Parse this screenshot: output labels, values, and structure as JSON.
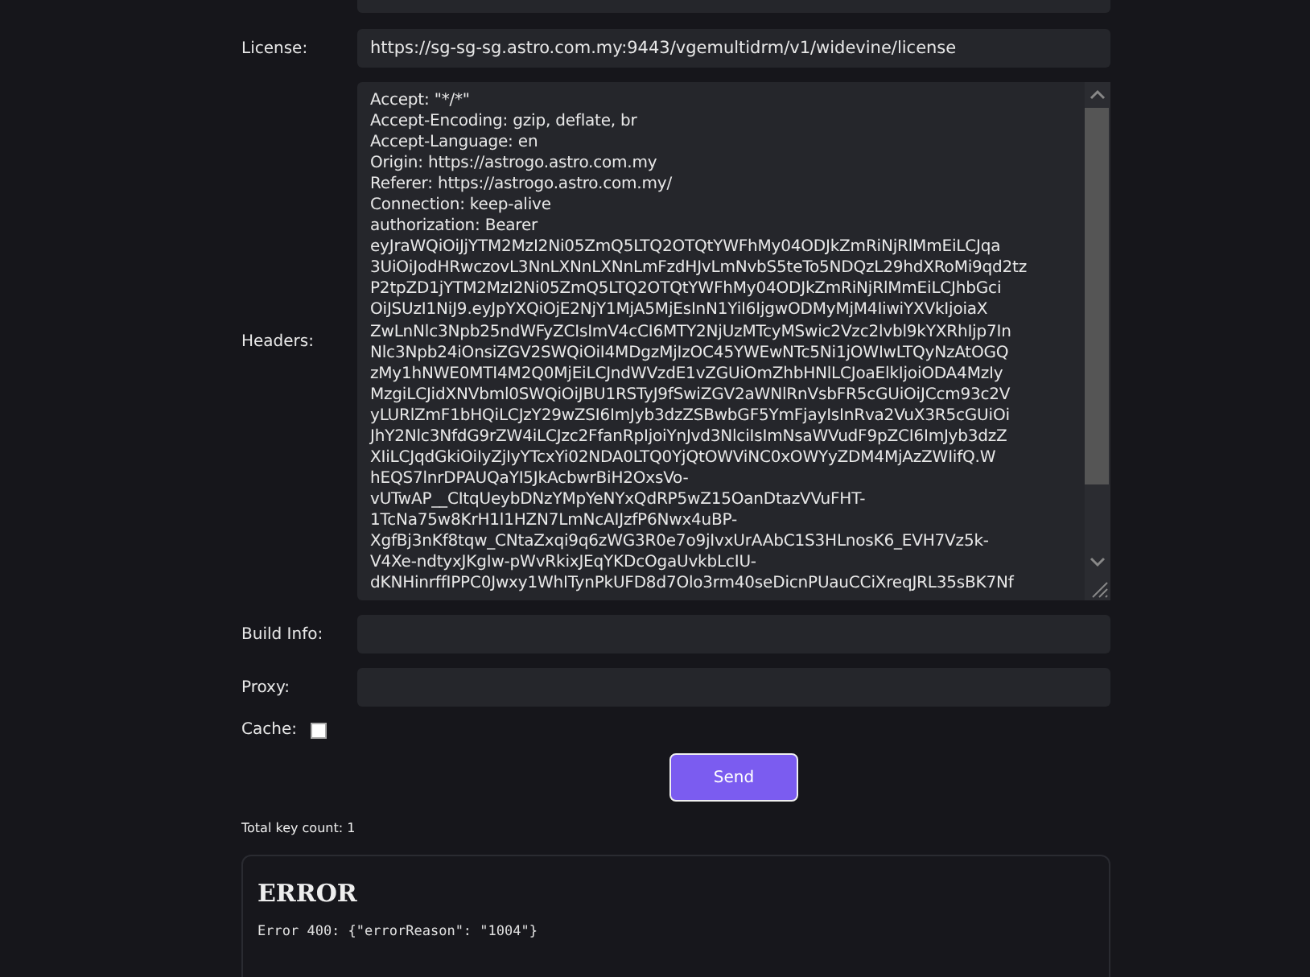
{
  "form": {
    "fields": [
      {
        "kind": "input"
      },
      {
        "kind": "input",
        "label": "License:",
        "value": "https://sg-sg-sg.astro.com.my:9443/vgemultidrm/v1/widevine/license"
      },
      {
        "kind": "textarea",
        "label": "Headers:",
        "lines": [
          "Accept: \"*/*\"",
          "Accept-Encoding: gzip, deflate, br",
          "Accept-Language: en",
          "Origin: https://astrogo.astro.com.my",
          "Referer: https://astrogo.astro.com.my/",
          "Connection: keep-alive",
          "authorization: Bearer",
          "eyJraWQiOiJjYTM2MzI2Ni05ZmQ5LTQ2OTQtYWFhMy04ODJkZmRiNjRlMmEiLCJqa",
          "3UiOiJodHRwczovL3NnLXNnLXNnLmFzdHJvLmNvbS5teTo5NDQzL29hdXRoMi9qd2tz",
          "P2tpZD1jYTM2MzI2Ni05ZmQ5LTQ2OTQtYWFhMy04ODJkZmRiNjRlMmEiLCJhbGci",
          "OiJSUzI1NiJ9.eyJpYXQiOjE2NjY1MjA5MjEsInN1YiI6IjgwODMyMjM4IiwiYXVkIjoiaX",
          "ZwLnNlc3Npb25ndWFyZCIsImV4cCI6MTY2NjUzMTcyMSwic2Vzc2lvbl9kYXRhIjp7In",
          "Nlc3Npb24iOnsiZGV2SWQiOiI4MDgzMjIzOC45YWEwNTc5Ni1jOWIwLTQyNzAtOGQ",
          "zMy1hNWE0MTI4M2Q0MjEiLCJndWVzdE1vZGUiOmZhbHNlLCJoaElkIjoiODA4MzIy",
          "MzgiLCJidXNVbml0SWQiOiJBU1RSTyJ9fSwiZGV2aWNlRnVsbFR5cGUiOiJCcm93c2V",
          "yLURlZmF1bHQiLCJzY29wZSI6ImJyb3dzZSBwbGF5YmFjayIsInRva2VuX3R5cGUiOi",
          "JhY2Nlc3NfdG9rZW4iLCJzc2FfanRpIjoiYnJvd3NlciIsImNsaWVudF9pZCI6ImJyb3dzZ",
          "XIiLCJqdGkiOiIyZjIyYTcxYi02NDA0LTQ0YjQtOWViNC0xOWYyZDM4MjAzZWIifQ.W",
          "hEQS7lnrDPAUQaYI5JkAcbwrBiH2OxsVo-",
          "vUTwAP__CItqUeybDNzYMpYeNYxQdRP5wZ15OanDtazVVuFHT-",
          "1TcNa75w8KrH1l1HZN7LmNcAIJzfP6Nwx4uBP-",
          "XgfBj3nKf8tqw_CNtaZxqi9q6zWG3R0e7o9jIvxUrAAbC1S3HLnosK6_EVH7Vz5k-",
          "V4Xe-ndtyxJKgIw-pWvRkixJEqYKDcOgaUvkbLcIU-",
          "dKNHinrffIPPC0Jwxy1WhITynPkUFD8d7Olo3rm40seDicnPUauCCiXreqJRL35sBK7Nf"
        ]
      },
      {
        "kind": "input",
        "label": "Build Info:"
      },
      {
        "kind": "input",
        "label": "Proxy:"
      },
      {
        "kind": "checkbox",
        "label": "Cache:",
        "checked": false
      }
    ],
    "send_button": "Send"
  },
  "total_key_count": "Total key count: 1",
  "error": {
    "title": "ERROR",
    "message": "Error 400: {\"errorReason\": \"1004\"}"
  }
}
